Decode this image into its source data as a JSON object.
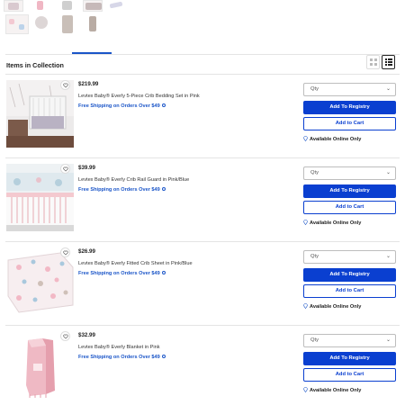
{
  "section_title": "Items in Collection",
  "colors": {
    "accent": "#0a3fd0",
    "link": "#1a55c8"
  },
  "products": [
    {
      "price": "$219.99",
      "name": "Levtex Baby® Everly 5-Piece Crib Bedding Set in Pink",
      "shipping": "Free Shipping on Orders Over $49",
      "qty_placeholder": "Qty",
      "add_registry": "Add To Registry",
      "add_cart": "Add to Cart",
      "availability": "Available Online Only",
      "image": "crib-bedding-set"
    },
    {
      "price": "$39.99",
      "name": "Levtex Baby® Everly Crib Rail Guard in Pink/Blue",
      "shipping": "Free Shipping on Orders Over $49",
      "qty_placeholder": "Qty",
      "add_registry": "Add To Registry",
      "add_cart": "Add to Cart",
      "availability": "Available Online Only",
      "image": "crib-rail-guard"
    },
    {
      "price": "$26.99",
      "name": "Levtex Baby® Everly Fitted Crib Sheet in Pink/Blue",
      "shipping": "Free Shipping on Orders Over $49",
      "qty_placeholder": "Qty",
      "add_registry": "Add To Registry",
      "add_cart": "Add to Cart",
      "availability": "Available Online Only",
      "image": "fitted-crib-sheet"
    },
    {
      "price": "$32.99",
      "name": "Levtex Baby® Everly Blanket in Pink",
      "shipping": "Free Shipping on Orders Over $49",
      "qty_placeholder": "Qty",
      "add_registry": "Add To Registry",
      "add_cart": "Add to Cart",
      "availability": "Available Online Only",
      "image": "baby-blanket"
    }
  ],
  "icons": {
    "wishlist": "heart-icon",
    "shipping_info": "info-icon",
    "availability": "location-pin-icon",
    "grid_view": "grid-view-icon",
    "list_view": "list-view-icon"
  }
}
